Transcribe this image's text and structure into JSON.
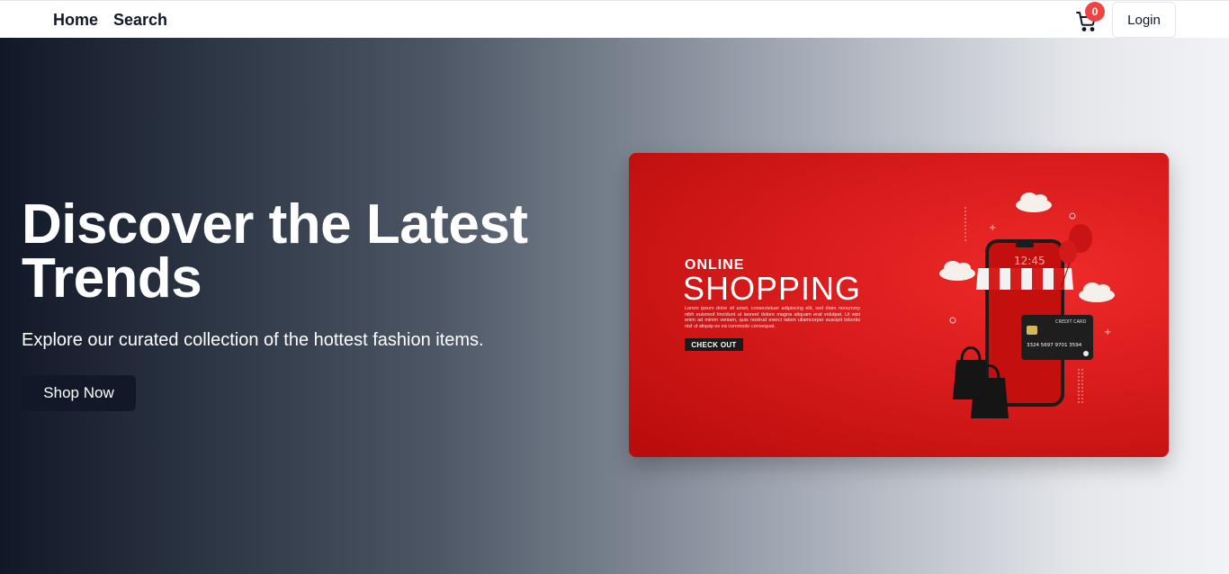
{
  "nav": {
    "home_label": "Home",
    "search_label": "Search",
    "cart_count": "0",
    "login_label": "Login"
  },
  "hero": {
    "title": "Discover the Latest Trends",
    "subtitle": "Explore our curated collection of the hottest fashion items.",
    "button_label": "Shop Now"
  },
  "banner": {
    "online": "ONLINE",
    "shopping": "SHOPPING",
    "lorem": "Lorem ipsum dolor sit amet, consectetuer adipiscing elit, sed diam nonummy nibh euismod tincidunt ut laoreet dolore magna aliquam erat volutpat. Ut wisi enim ad minim veniam, quis nostrud exerci tation ullamcorper suscipit lobortis nisl ut aliquip ex ea commodo consequat.",
    "checkout": "CHECK OUT",
    "phone_time": "12:45",
    "card_label": "CREDIT CARD",
    "card_number": "3324 5697 9701 3594"
  },
  "colors": {
    "hero_dark": "#111827",
    "banner_red": "#d81b1b",
    "badge_red": "#ef4444"
  }
}
